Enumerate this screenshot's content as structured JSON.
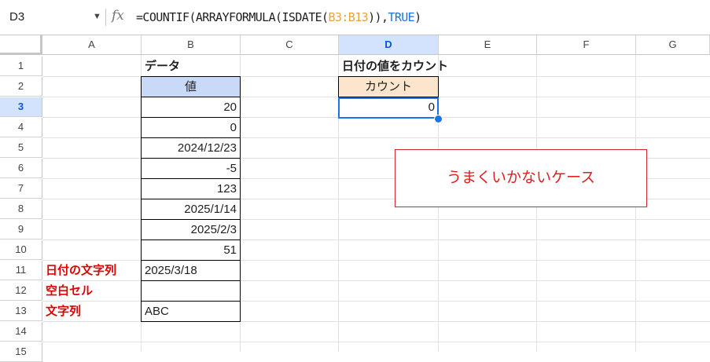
{
  "formula_bar": {
    "cell_ref": "D3",
    "formula_prefix": "=COUNTIF(ARRAYFORMULA(ISDATE(",
    "formula_range": "B3:B13",
    "formula_mid": ")),",
    "formula_true": "TRUE",
    "formula_suffix": ")"
  },
  "columns": [
    "A",
    "B",
    "C",
    "D",
    "E",
    "F",
    "G"
  ],
  "rows": [
    "1",
    "2",
    "3",
    "4",
    "5",
    "6",
    "7",
    "8",
    "9",
    "10",
    "11",
    "12",
    "13",
    "14",
    "15"
  ],
  "selected_column": "D",
  "selected_row": "3",
  "cells": {
    "b1": "データ",
    "d1": "日付の値をカウント",
    "b2": "値",
    "d2": "カウント",
    "d3": "0",
    "b_values": [
      "20",
      "0",
      "2024/12/23",
      "-5",
      "123",
      "2025/1/14",
      "2025/2/3",
      "51"
    ],
    "b11": "2025/3/18",
    "b12": "",
    "b13": "ABC",
    "a11": "日付の文字列",
    "a12": "空白セル",
    "a13": "文字列"
  },
  "note": "うまくいかないケース",
  "colors": {
    "header_blue": "#c9daf8",
    "header_peach": "#fce5cd",
    "selection_blue": "#1a73e8",
    "note_red": "#e02020"
  }
}
